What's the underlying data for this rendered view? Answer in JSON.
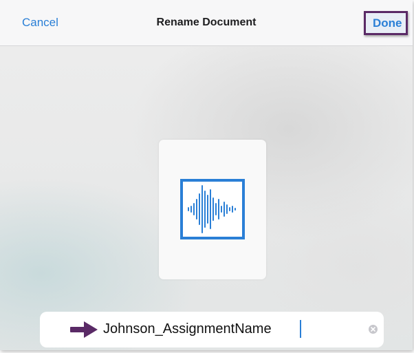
{
  "navbar": {
    "cancel_label": "Cancel",
    "title": "Rename Document",
    "done_label": "Done"
  },
  "document": {
    "icon": "audio-waveform-icon"
  },
  "name_field": {
    "value": "Johnson_AssignmentName",
    "leading_icon": "right-arrow-icon",
    "clear_icon": "clear-x-icon"
  },
  "colors": {
    "accent": "#2a7fd6",
    "highlight_border": "#5a2a66",
    "arrow": "#5a2a66"
  }
}
